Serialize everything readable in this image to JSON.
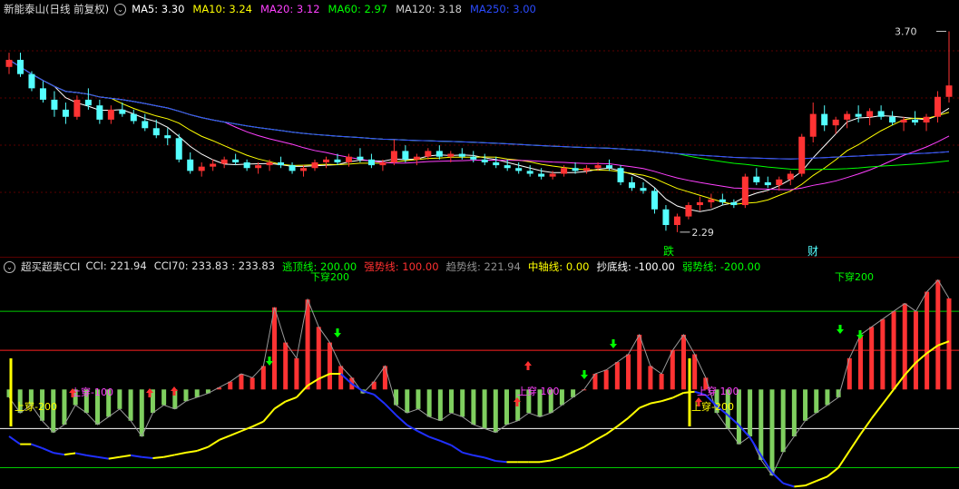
{
  "title_bar": {
    "stock": "新能泰山(日线 前复权)",
    "mas": [
      {
        "label": "MA5: 3.30",
        "color": "#ffffff"
      },
      {
        "label": "MA10: 3.24",
        "color": "#ffff00"
      },
      {
        "label": "MA20: 3.12",
        "color": "#ff40ff"
      },
      {
        "label": "MA60: 2.97",
        "color": "#00ff00"
      },
      {
        "label": "MA120: 3.18",
        "color": "#d0d0d0"
      },
      {
        "label": "MA250: 3.00",
        "color": "#2b4bff"
      }
    ]
  },
  "indicator_bar": {
    "name": "超买超卖CCI",
    "items": [
      {
        "label": "CCI: 221.94",
        "color": "#e0e0e0"
      },
      {
        "label": "CCI70: 233.83 : 233.83",
        "color": "#e0e0e0"
      },
      {
        "label": "逃顶线: 200.00",
        "color": "#00ff00"
      },
      {
        "label": "强势线: 100.00",
        "color": "#ff3030"
      },
      {
        "label": "趋势线: 221.94",
        "color": "#909090"
      },
      {
        "label": "中轴线: 0.00",
        "color": "#ffff00"
      },
      {
        "label": "抄底线: -100.00",
        "color": "#ffffff"
      },
      {
        "label": "弱势线: -200.00",
        "color": "#00ff00"
      }
    ]
  },
  "price_annotations": {
    "high": "3.70",
    "low": "2.29"
  },
  "event_markers": {
    "fall": "跌",
    "finance": "财"
  },
  "signal_labels": {
    "cross_up_neg200": "上穿-200",
    "cross_up_neg100": "上穿-100",
    "cross_up_100": "上穿 100",
    "cross_down_200": "下穿200"
  },
  "colors": {
    "up": "#ff3333",
    "down": "#54ffff",
    "hist_pos": "#ff3333",
    "hist_neg": "#7fcf5f"
  },
  "chart_data": {
    "type": "candlestick",
    "y_range": [
      2.2,
      3.78
    ],
    "candles": [
      [
        3.45,
        3.55,
        3.4,
        3.5
      ],
      [
        3.5,
        3.55,
        3.38,
        3.4
      ],
      [
        3.4,
        3.42,
        3.28,
        3.3
      ],
      [
        3.3,
        3.35,
        3.2,
        3.22
      ],
      [
        3.22,
        3.28,
        3.1,
        3.15
      ],
      [
        3.15,
        3.2,
        3.05,
        3.1
      ],
      [
        3.1,
        3.25,
        3.08,
        3.22
      ],
      [
        3.22,
        3.3,
        3.15,
        3.18
      ],
      [
        3.18,
        3.22,
        3.05,
        3.08
      ],
      [
        3.08,
        3.18,
        3.05,
        3.15
      ],
      [
        3.15,
        3.2,
        3.1,
        3.12
      ],
      [
        3.12,
        3.15,
        3.05,
        3.07
      ],
      [
        3.07,
        3.12,
        3.0,
        3.02
      ],
      [
        3.02,
        3.08,
        2.95,
        2.97
      ],
      [
        2.97,
        3.02,
        2.9,
        2.95
      ],
      [
        2.95,
        2.98,
        2.78,
        2.8
      ],
      [
        2.8,
        2.85,
        2.7,
        2.72
      ],
      [
        2.72,
        2.78,
        2.68,
        2.75
      ],
      [
        2.75,
        2.8,
        2.72,
        2.77
      ],
      [
        2.77,
        2.82,
        2.74,
        2.8
      ],
      [
        2.8,
        2.84,
        2.76,
        2.78
      ],
      [
        2.78,
        2.8,
        2.72,
        2.74
      ],
      [
        2.74,
        2.78,
        2.7,
        2.76
      ],
      [
        2.76,
        2.8,
        2.72,
        2.78
      ],
      [
        2.78,
        2.82,
        2.74,
        2.76
      ],
      [
        2.76,
        2.78,
        2.7,
        2.72
      ],
      [
        2.72,
        2.76,
        2.68,
        2.74
      ],
      [
        2.74,
        2.8,
        2.72,
        2.78
      ],
      [
        2.78,
        2.82,
        2.74,
        2.8
      ],
      [
        2.8,
        2.84,
        2.76,
        2.78
      ],
      [
        2.78,
        2.84,
        2.75,
        2.82
      ],
      [
        2.82,
        2.88,
        2.78,
        2.8
      ],
      [
        2.8,
        2.84,
        2.74,
        2.76
      ],
      [
        2.76,
        2.8,
        2.72,
        2.78
      ],
      [
        2.78,
        2.94,
        2.76,
        2.86
      ],
      [
        2.86,
        2.9,
        2.78,
        2.8
      ],
      [
        2.8,
        2.84,
        2.76,
        2.82
      ],
      [
        2.82,
        2.88,
        2.8,
        2.86
      ],
      [
        2.86,
        2.9,
        2.8,
        2.82
      ],
      [
        2.82,
        2.86,
        2.78,
        2.84
      ],
      [
        2.84,
        2.88,
        2.8,
        2.82
      ],
      [
        2.82,
        2.86,
        2.78,
        2.8
      ],
      [
        2.8,
        2.84,
        2.76,
        2.78
      ],
      [
        2.78,
        2.82,
        2.74,
        2.76
      ],
      [
        2.76,
        2.8,
        2.72,
        2.74
      ],
      [
        2.74,
        2.78,
        2.7,
        2.72
      ],
      [
        2.72,
        2.76,
        2.68,
        2.7
      ],
      [
        2.7,
        2.74,
        2.66,
        2.68
      ],
      [
        2.68,
        2.72,
        2.66,
        2.7
      ],
      [
        2.7,
        2.76,
        2.68,
        2.74
      ],
      [
        2.74,
        2.78,
        2.7,
        2.72
      ],
      [
        2.72,
        2.76,
        2.7,
        2.74
      ],
      [
        2.74,
        2.78,
        2.72,
        2.76
      ],
      [
        2.76,
        2.8,
        2.72,
        2.74
      ],
      [
        2.74,
        2.76,
        2.62,
        2.64
      ],
      [
        2.64,
        2.68,
        2.58,
        2.6
      ],
      [
        2.6,
        2.64,
        2.56,
        2.58
      ],
      [
        2.58,
        2.6,
        2.42,
        2.45
      ],
      [
        2.45,
        2.48,
        2.3,
        2.34
      ],
      [
        2.34,
        2.42,
        2.29,
        2.4
      ],
      [
        2.4,
        2.5,
        2.38,
        2.48
      ],
      [
        2.48,
        2.54,
        2.44,
        2.5
      ],
      [
        2.5,
        2.56,
        2.46,
        2.52
      ],
      [
        2.52,
        2.56,
        2.48,
        2.5
      ],
      [
        2.5,
        2.52,
        2.46,
        2.48
      ],
      [
        2.48,
        2.7,
        2.46,
        2.68
      ],
      [
        2.68,
        2.74,
        2.62,
        2.64
      ],
      [
        2.64,
        2.68,
        2.6,
        2.62
      ],
      [
        2.62,
        2.68,
        2.58,
        2.66
      ],
      [
        2.66,
        2.72,
        2.62,
        2.7
      ],
      [
        2.7,
        2.98,
        2.68,
        2.96
      ],
      [
        2.96,
        3.2,
        2.92,
        3.12
      ],
      [
        3.12,
        3.18,
        3.0,
        3.04
      ],
      [
        3.04,
        3.1,
        2.98,
        3.08
      ],
      [
        3.08,
        3.14,
        3.02,
        3.12
      ],
      [
        3.12,
        3.18,
        3.06,
        3.1
      ],
      [
        3.1,
        3.16,
        3.04,
        3.14
      ],
      [
        3.14,
        3.18,
        3.08,
        3.1
      ],
      [
        3.1,
        3.14,
        3.04,
        3.06
      ],
      [
        3.06,
        3.1,
        3.0,
        3.08
      ],
      [
        3.08,
        3.14,
        3.04,
        3.06
      ],
      [
        3.06,
        3.12,
        3.0,
        3.1
      ],
      [
        3.1,
        3.28,
        3.06,
        3.24
      ],
      [
        3.24,
        3.7,
        3.2,
        3.32
      ]
    ],
    "cci": [
      -20,
      -60,
      -40,
      -80,
      -110,
      -90,
      -40,
      -60,
      -90,
      -70,
      -50,
      -80,
      -120,
      -60,
      -40,
      -50,
      -30,
      -20,
      -10,
      5,
      20,
      40,
      30,
      60,
      210,
      120,
      80,
      230,
      160,
      120,
      60,
      30,
      -10,
      20,
      60,
      -40,
      -60,
      -50,
      -70,
      -80,
      -60,
      -70,
      -90,
      -100,
      -110,
      -90,
      -80,
      -60,
      -70,
      -60,
      -40,
      -20,
      0,
      40,
      50,
      70,
      90,
      140,
      60,
      40,
      100,
      140,
      90,
      30,
      -60,
      -100,
      -140,
      -120,
      -180,
      -220,
      -160,
      -120,
      -80,
      -60,
      -40,
      -20,
      80,
      140,
      160,
      180,
      200,
      220,
      200,
      250,
      280,
      233
    ]
  }
}
